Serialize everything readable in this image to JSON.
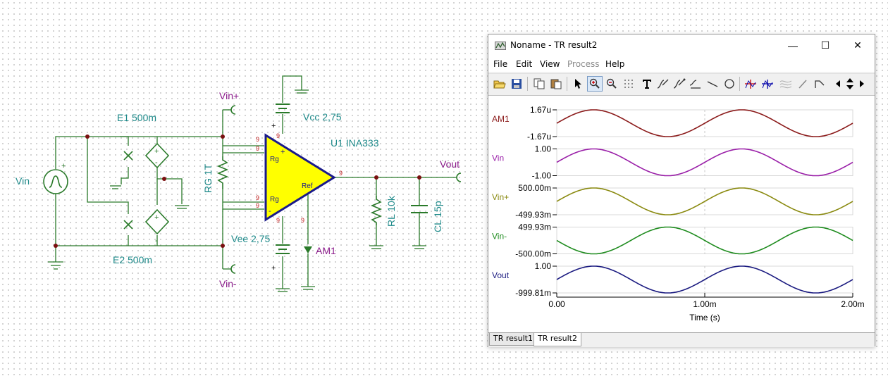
{
  "schematic": {
    "labels": {
      "vin": "Vin",
      "e1": "E1 500m",
      "e2": "E2 500m",
      "rg": "RG 1T",
      "vin_plus": "Vin+",
      "vin_minus": "Vin-",
      "vcc": "Vcc 2,75",
      "vee": "Vee 2,75",
      "u1": "U1 INA333",
      "vout": "Vout",
      "rl": "RL 10k",
      "cl": "CL 15p",
      "am1": "AM1",
      "pin_rg_top": "Rg",
      "pin_rg_bottom": "Rg",
      "pin_ref": "Ref",
      "pin_plus": "+",
      "pin_minus": "-",
      "src_plus": "+",
      "dep_plus": "+",
      "dep_minus": "-",
      "vcc_plus": "+",
      "vee_plus": "+",
      "pin9": "9"
    }
  },
  "window": {
    "title": "Noname - TR result2",
    "controls": {
      "minimize": "—",
      "maximize": "☐",
      "close": "✕"
    },
    "menu": [
      "File",
      "Edit",
      "View",
      "Process",
      "Help"
    ],
    "menu_disabled": [
      "Process"
    ],
    "tabs": [
      "TR result1",
      "TR result2"
    ],
    "active_tab": "TR result2"
  },
  "chart_data": {
    "type": "line",
    "xlabel": "Time (s)",
    "xlim": [
      0,
      0.002
    ],
    "xticks": [
      "0.00",
      "1.00m",
      "2.00m"
    ],
    "series": [
      {
        "name": "AM1",
        "color": "#8b1a1a",
        "ymax_label": "1.67u",
        "ymin_label": "-1.67u",
        "ylim": [
          -1.67e-06,
          1.67e-06
        ],
        "amplitude": 1.67e-06,
        "offset": 0,
        "phase": 0
      },
      {
        "name": "Vin",
        "color": "#9a1fa8",
        "ymax_label": "1.00",
        "ymin_label": "-1.00",
        "ylim": [
          -1.0,
          1.0
        ],
        "amplitude": 1.0,
        "offset": 0,
        "phase": 0
      },
      {
        "name": "Vin+",
        "color": "#8a8a10",
        "ymax_label": "500.00m",
        "ymin_label": "-499.93m",
        "ylim": [
          -0.49993,
          0.5
        ],
        "amplitude": 0.5,
        "offset": 0,
        "phase": 0
      },
      {
        "name": "Vin-",
        "color": "#1f8c1f",
        "ymax_label": "499.93m",
        "ymin_label": "-500.00m",
        "ylim": [
          -0.5,
          0.49993
        ],
        "amplitude": 0.5,
        "offset": 0,
        "phase": 180
      },
      {
        "name": "Vout",
        "color": "#1a1a80",
        "ymax_label": "1.00",
        "ymin_label": "-999.81m",
        "ylim": [
          -0.99981,
          1.0
        ],
        "amplitude": 1.0,
        "offset": 0,
        "phase": 0
      }
    ],
    "frequency_hz": 1000,
    "grid": "vertical dashed at 1.00m"
  }
}
